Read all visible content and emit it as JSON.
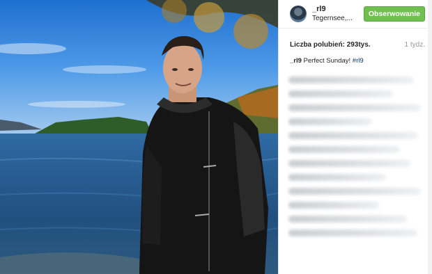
{
  "post": {
    "username": "_rl9",
    "location": "Tegernsee,...",
    "follow_label": "Obserwowanie",
    "likes_text": "Liczba polubień: 293tys.",
    "time_ago": "1 tydz.",
    "caption_user": "_rl9",
    "caption_text": " Perfect Sunday! ",
    "caption_hashtag": "#rl9"
  },
  "colors": {
    "follow_button": "#70c050",
    "hashtag": "#003569"
  },
  "icons": {
    "avatar": "avatar"
  }
}
